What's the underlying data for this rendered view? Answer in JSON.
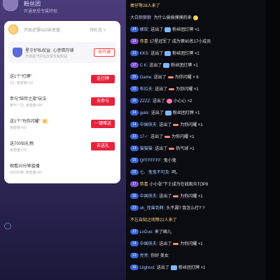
{
  "left": {
    "top_title": "粉丝团",
    "top_sub": "开通享受专属特权",
    "fan_info": "开始还需420亲密度",
    "fan_link": "领礼包 >",
    "guard": {
      "title": "星守护私权益: 心意情存储",
      "sub": "开通星守护后享受专属权益",
      "button": "去开通"
    },
    "tasks": [
      {
        "title": "送1个\"打牌\"",
        "sub": "1/1, 亲密度+10",
        "button": "送打牌"
      },
      {
        "title": "参与\"陪伴之旅\"玩法",
        "sub": "参与一次, 亲密度+20",
        "button": "去参与"
      },
      {
        "title": "送1个\"为你闪耀\"",
        "tag": "新",
        "sub": "亲密度+50",
        "button": "一键赠送"
      },
      {
        "title": "送700钻礼物",
        "sub": "亲密度+70",
        "button": "去送礼"
      },
      {
        "title": "观看20分钟直播",
        "sub": "0/20分钟, 亲密度+50",
        "button": ""
      }
    ]
  },
  "chat": [
    {
      "type": "sys",
      "text": "棒仔等28人来了"
    },
    {
      "badges": [],
      "nick": "大白狼狼狼 ",
      "text": "为什么偷偷摸摸的来",
      "icon": "face",
      "nick_color": "c-light"
    },
    {
      "badges": [
        {
          "t": "14",
          "c": "b-blue"
        }
      ],
      "nick": "娜玫:",
      "text": "送出了",
      "icon": "gift",
      "after": "粉丝团灯牌 ×1"
    },
    {
      "badges": [
        {
          "t": "13",
          "c": "b-purple"
        }
      ],
      "nick": "恭喜",
      "text": "17星冠军了 成为第90名17小成员",
      "nick_color": "c-yellow"
    },
    {
      "badges": [
        {
          "t": "13",
          "c": "b-blue"
        }
      ],
      "nick": "KKS:",
      "text": "送出了",
      "icon": "gift",
      "after": "粉丝团灯牌 ×1"
    },
    {
      "badges": [
        {
          "t": "17",
          "c": "b-purple"
        }
      ],
      "nick": "C K:",
      "text": "送出了",
      "icon": "gift",
      "after": "粉丝团灯牌 ×1"
    },
    {
      "badges": [
        {
          "t": "15",
          "c": "b-blue"
        }
      ],
      "nick": "Game:",
      "text": "送出了",
      "icon": "lightstick",
      "after": "为你闪耀 × 6"
    },
    {
      "badges": [
        {
          "t": "12",
          "c": "b-blue"
        }
      ],
      "nick": "布拉夫:",
      "text": "送出了",
      "icon": "lightstick",
      "after": "为你闪耀 ×1"
    },
    {
      "badges": [
        {
          "t": "16",
          "c": "b-blue"
        }
      ],
      "nick": "ZZZZ:",
      "text": "送出了",
      "icon": "heart",
      "after": "小心心 ×2"
    },
    {
      "badges": [
        {
          "t": "14",
          "c": "b-blue"
        }
      ],
      "nick": "gukk:",
      "text": "送出了",
      "icon": "gift",
      "after": "粉丝团灯牌 ×1"
    },
    {
      "badges": [
        {
          "t": "14",
          "c": "b-blue"
        }
      ],
      "nick": "中国俠夫:",
      "text": "送出了",
      "icon": "lightstick",
      "after": "为你闪耀 ×1"
    },
    {
      "badges": [
        {
          "t": "13",
          "c": "b-blue"
        }
      ],
      "nick": "17✓:",
      "text": "送出了",
      "icon": "lightstick",
      "after": "为你闪耀 ×1"
    },
    {
      "badges": [
        {
          "t": "13",
          "c": "b-blue"
        }
      ],
      "nick": "猫猫猫:",
      "text": "送出了",
      "icon": "lightstick",
      "after": "热气球 ×1"
    },
    {
      "badges": [
        {
          "t": "16",
          "c": "b-blue"
        }
      ],
      "nick": "QFFFFFFF:",
      "text": "鬼小鬼"
    },
    {
      "badges": [
        {
          "t": "22",
          "c": "b-blue"
        }
      ],
      "nick": "七、鬼鬼不可及:",
      "text": "呵。"
    },
    {
      "badges": [
        {
          "t": "17",
          "c": "b-purple"
        }
      ],
      "nick": "恭喜",
      "text": "小小张\"下士成为在线观众TOP8",
      "nick_color": "c-yellow"
    },
    {
      "badges": [
        {
          "t": "16",
          "c": "b-blue"
        }
      ],
      "nick": "中国俠夫:",
      "text": "送出了",
      "icon": "lightstick",
      "after": "为你闪耀 ×1"
    },
    {
      "badges": [
        {
          "t": "13",
          "c": "b-blue"
        }
      ],
      "nick": "oh_怪兽到啊:",
      "text": "头不漏? 我怎么打? ?"
    },
    {
      "type": "sys",
      "text": "不忘自知之明等22人来了"
    },
    {
      "badges": [
        {
          "t": "13",
          "c": "b-blue"
        }
      ],
      "nick": "LnDuo:",
      "text": "来了姨儿"
    },
    {
      "badges": [
        {
          "t": "14",
          "c": "b-blue"
        }
      ],
      "nick": "中国俠夫:",
      "text": "送出了",
      "icon": "lightstick",
      "after": "为你闪耀 ×1"
    },
    {
      "badges": [
        {
          "t": "13",
          "c": "b-blue"
        }
      ],
      "nick": "亮亮:",
      "text": "你好 美女"
    },
    {
      "badges": [
        {
          "t": "16",
          "c": "b-blue"
        }
      ],
      "nick": "Lilghost:",
      "text": "送出了",
      "icon": "gift",
      "after": "粉丝团灯牌 ×1"
    }
  ]
}
